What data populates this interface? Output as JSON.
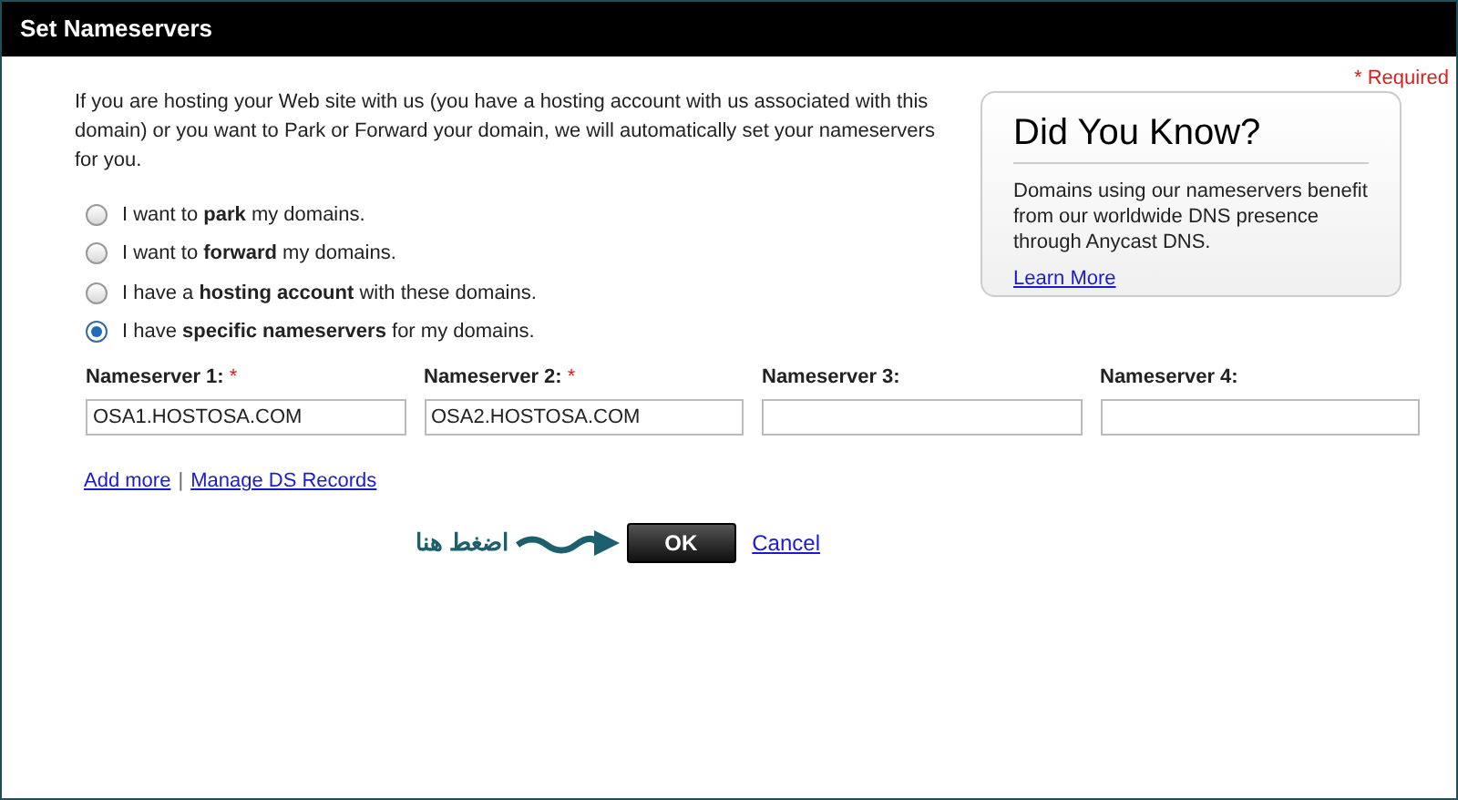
{
  "window": {
    "title": "Set Nameservers"
  },
  "required_note": "* Required",
  "intro": "If you are hosting your Web site with us (you have a hosting account with us associated with this domain) or you want to Park or Forward your domain, we will automatically set your nameservers for you.",
  "options": [
    {
      "label": "I want to **park** my domains.",
      "selected": false
    },
    {
      "label": "I want to **forward** my domains.",
      "selected": false
    },
    {
      "label": "I have a **hosting account** with these domains.",
      "selected": false
    },
    {
      "label": "I have **specific nameservers** for my domains.",
      "selected": true
    }
  ],
  "nameservers": [
    {
      "label": "Nameserver 1:",
      "required_mark": "*",
      "value": "OSA1.HOSTOSA.COM"
    },
    {
      "label": "Nameserver 2:",
      "required_mark": "*",
      "value": "OSA2.HOSTOSA.COM"
    },
    {
      "label": "Nameserver 3:"
    },
    {
      "label": "Nameserver 4:"
    }
  ],
  "links": [
    "Add more",
    "Manage DS Records"
  ],
  "link_separator": "|",
  "annotation": "اضغط هنا",
  "buttons": {
    "ok": "OK",
    "cancel": "Cancel"
  },
  "did_you_know": {
    "title": "Did You Know?",
    "text": "Domains using our nameservers benefit from our worldwide DNS presence through Anycast DNS.",
    "link": "Learn More"
  }
}
